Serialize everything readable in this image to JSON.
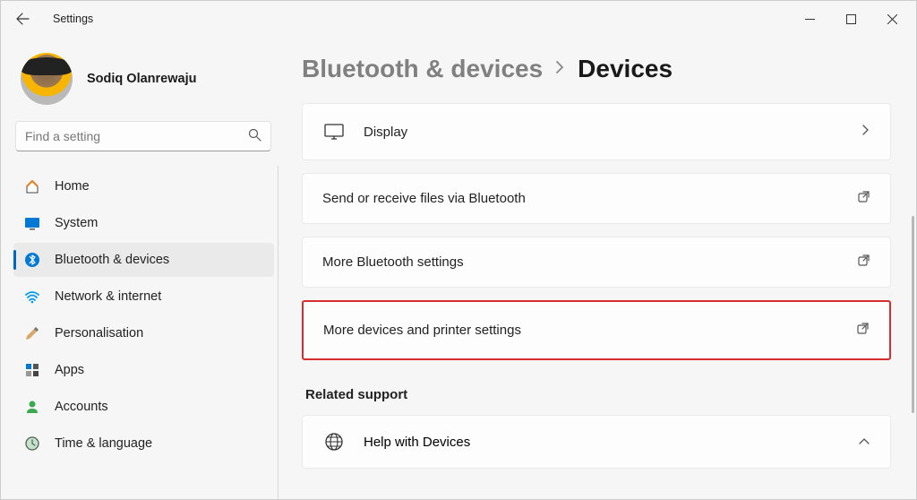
{
  "titlebar": {
    "title": "Settings"
  },
  "profile": {
    "name": "Sodiq Olanrewaju"
  },
  "search": {
    "placeholder": "Find a setting"
  },
  "sidebar": {
    "items": [
      {
        "icon": "home",
        "label": "Home"
      },
      {
        "icon": "system",
        "label": "System"
      },
      {
        "icon": "bluetooth",
        "label": "Bluetooth & devices"
      },
      {
        "icon": "network",
        "label": "Network & internet"
      },
      {
        "icon": "personalisation",
        "label": "Personalisation"
      },
      {
        "icon": "apps",
        "label": "Apps"
      },
      {
        "icon": "accounts",
        "label": "Accounts"
      },
      {
        "icon": "time",
        "label": "Time & language"
      }
    ]
  },
  "breadcrumb": {
    "parent": "Bluetooth & devices",
    "current": "Devices"
  },
  "cards": {
    "display": "Display",
    "send_receive": "Send or receive files via Bluetooth",
    "more_bt": "More Bluetooth settings",
    "more_devices": "More devices and printer settings"
  },
  "related": {
    "title": "Related support",
    "help": "Help with Devices"
  }
}
